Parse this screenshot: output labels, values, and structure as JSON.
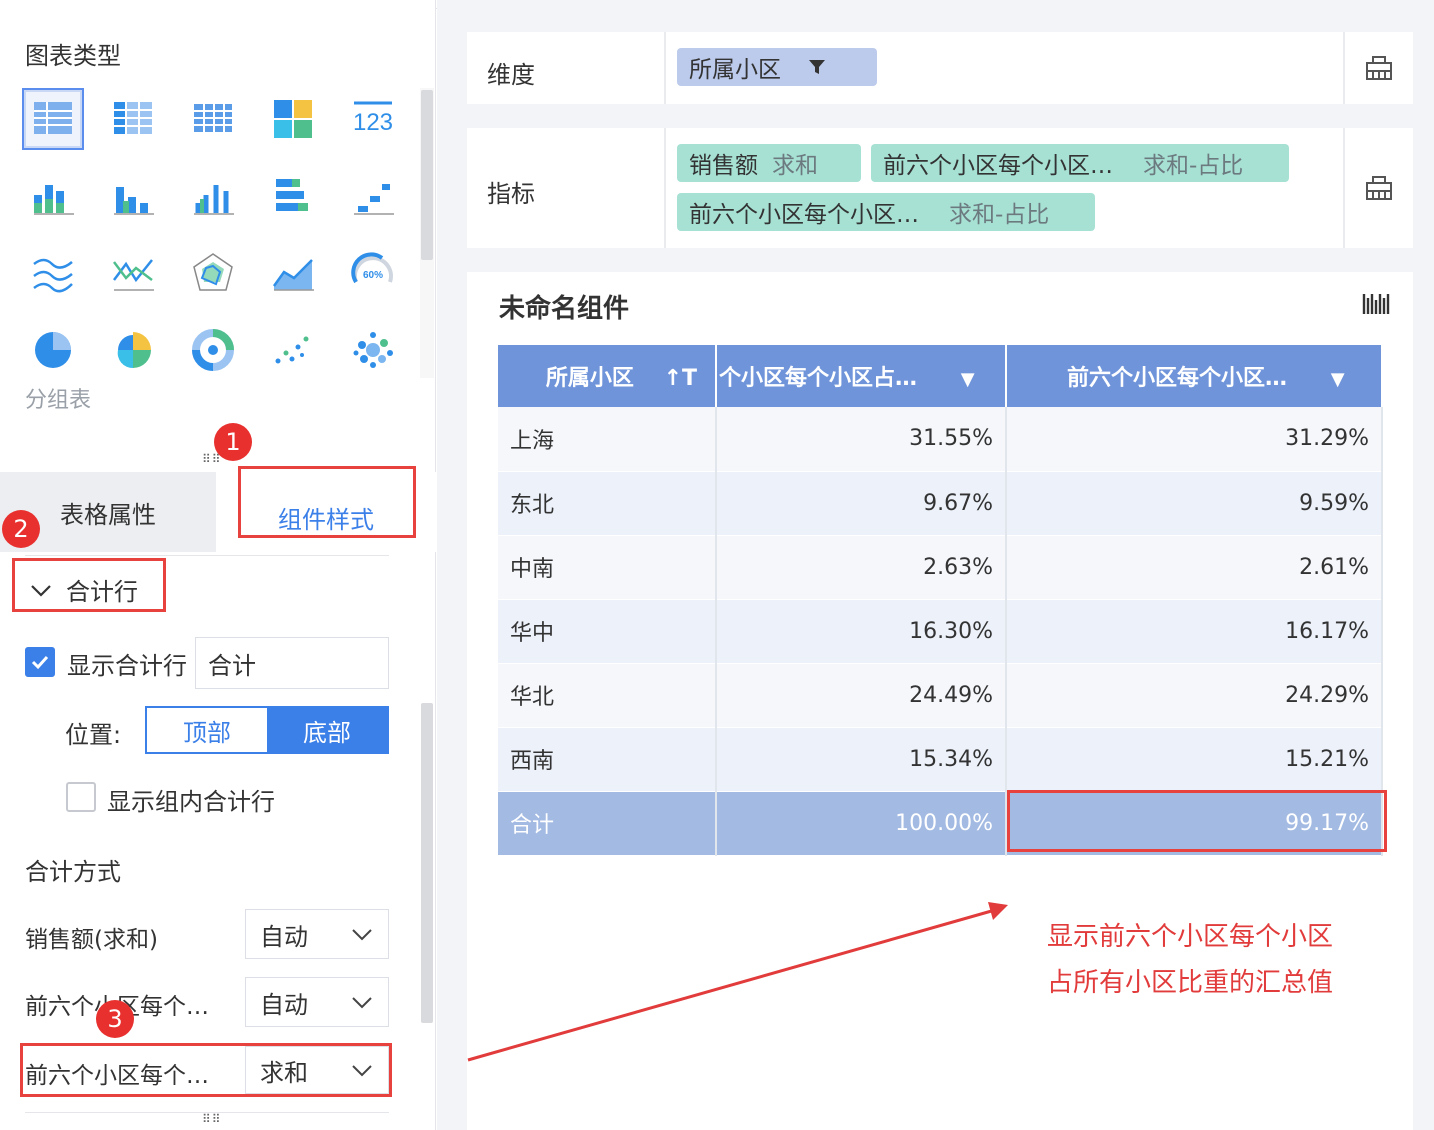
{
  "left_panel": {
    "chart_type_title": "图表类型",
    "chart_type_name": "分组表",
    "chart_icons": [
      "table-icon",
      "crosstab-icon",
      "detail-table-icon",
      "treemap-icon",
      "kpi-number-icon",
      "stacked-bar-icon",
      "bar-chart-icon",
      "grouped-bar-icon",
      "horizontal-bar-icon",
      "range-bar-icon",
      "area-line-icon",
      "line-chart-icon",
      "radar-icon",
      "area-chart-icon",
      "gauge-icon",
      "pie-icon",
      "rose-pie-icon",
      "donut-icon",
      "scatter-icon",
      "bubble-icon"
    ],
    "kpi_label": "123",
    "gauge_label": "60%",
    "tabs": [
      "表格属性",
      "组件样式"
    ],
    "section_title": "合计行",
    "show_total_label": "显示合计行",
    "total_text_value": "合计",
    "position_label": "位置:",
    "position_options": [
      "顶部",
      "底部"
    ],
    "show_group_total_label": "显示组内合计行",
    "method_title": "合计方式",
    "method_rows": [
      {
        "label": "销售额(求和)",
        "value": "自动"
      },
      {
        "label": "前六个小区每个…",
        "value": "自动"
      },
      {
        "label": "前六个小区每个…",
        "value": "求和"
      }
    ],
    "badges": [
      "1",
      "2",
      "3"
    ]
  },
  "fields": {
    "dimension_label": "维度",
    "dimension_pill": "所属小区",
    "metric_label": "指标",
    "metric_pills": [
      {
        "name": "销售额",
        "agg": "求和"
      },
      {
        "name": "前六个小区每个小区…",
        "agg": "求和-占比"
      },
      {
        "name": "前六个小区每个小区…",
        "agg": "求和-占比"
      }
    ]
  },
  "component": {
    "title": "未命名组件",
    "table": {
      "headers": [
        "所属小区",
        "个小区每个小区占…",
        "前六个小区每个小区…"
      ],
      "rows": [
        [
          "上海",
          "31.55%",
          "31.29%"
        ],
        [
          "东北",
          "9.67%",
          "9.59%"
        ],
        [
          "中南",
          "2.63%",
          "2.61%"
        ],
        [
          "华中",
          "16.30%",
          "16.17%"
        ],
        [
          "华北",
          "24.49%",
          "24.29%"
        ],
        [
          "西南",
          "15.34%",
          "15.21%"
        ]
      ],
      "total": [
        "合计",
        "100.00%",
        "99.17%"
      ]
    }
  },
  "annotation": {
    "line1": "显示前六个小区每个小区",
    "line2": "占所有小区比重的汇总值"
  },
  "colors": {
    "accent": "#3b7fe8",
    "header": "#6f94da",
    "total_row": "#a3bae3",
    "highlight_red": "#e8423f"
  }
}
